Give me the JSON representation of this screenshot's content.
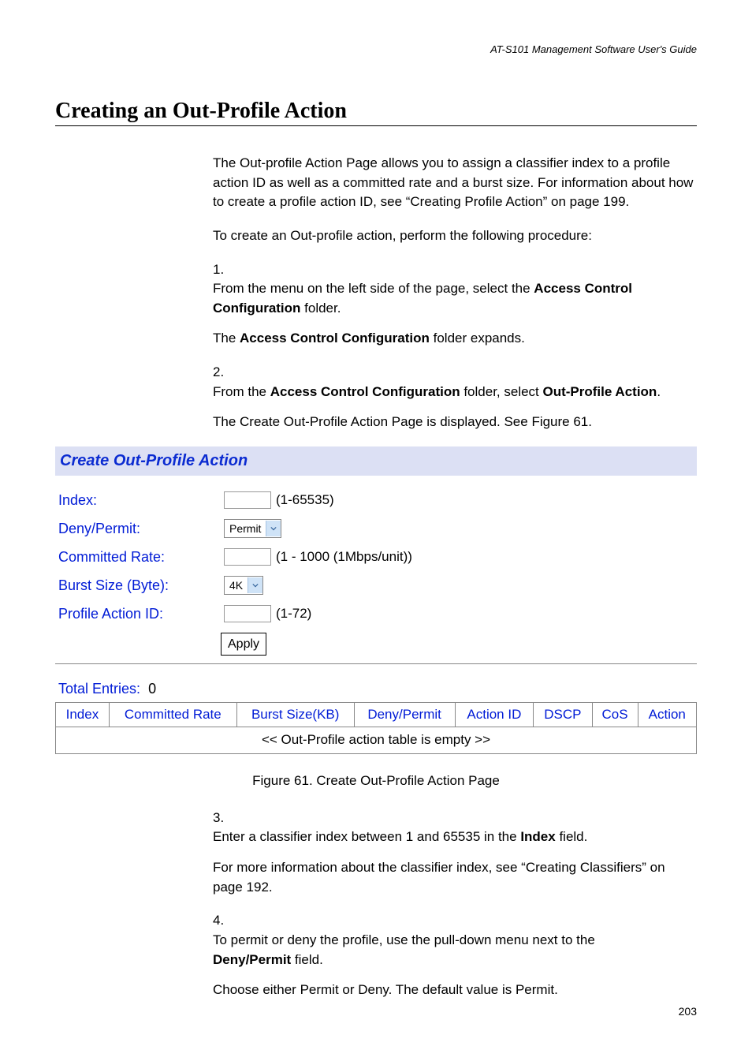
{
  "running_header": "AT-S101 Management Software User's Guide",
  "section_title": "Creating an Out-Profile Action",
  "intro_para": "The Out-profile Action Page allows you to assign a classifier index to a profile action ID as well as a committed rate and a burst size. For information about how to create a profile action ID, see “Creating Profile Action” on page 199.",
  "lead_in": "To create an Out-profile action, perform the following procedure:",
  "steps": {
    "s1_num": "1.",
    "s1_line1_a": "From the menu on the left side of the page, select the ",
    "s1_line1_b": "Access Control Configuration",
    "s1_line1_c": " folder.",
    "s1_line2_a": "The ",
    "s1_line2_b": "Access Control Configuration",
    "s1_line2_c": " folder expands.",
    "s2_num": "2.",
    "s2_line1_a": "From the ",
    "s2_line1_b": "Access Control Configuration",
    "s2_line1_c": " folder, select ",
    "s2_line1_d": "Out-Profile Action",
    "s2_line1_e": ".",
    "s2_line2": "The Create Out-Profile Action Page is displayed. See Figure 61.",
    "s3_num": "3.",
    "s3_line1_a": "Enter a classifier index between 1 and 65535 in the ",
    "s3_line1_b": "Index",
    "s3_line1_c": " field.",
    "s3_line2": "For more information about the classifier index, see “Creating Classifiers” on page 192.",
    "s4_num": "4.",
    "s4_line1_a": "To permit or deny the profile, use the pull-down menu next to the ",
    "s4_line1_b": "Deny/Permit",
    "s4_line1_c": " field.",
    "s4_line2": "Choose either Permit or Deny. The default value is Permit."
  },
  "figure": {
    "panel_title": "Create Out-Profile Action",
    "labels": {
      "index": "Index:",
      "deny_permit": "Deny/Permit:",
      "committed_rate": "Committed Rate:",
      "burst_size": "Burst Size (Byte):",
      "profile_action_id": "Profile Action ID:"
    },
    "hints": {
      "index": "(1-65535)",
      "committed_rate": "(1 - 1000 (1Mbps/unit))",
      "profile_action_id": "(1-72)"
    },
    "selects": {
      "deny_permit_value": "Permit",
      "burst_size_value": "4K"
    },
    "apply_label": "Apply",
    "total_entries_label": "Total Entries:",
    "total_entries_value": "0",
    "columns": {
      "c0": "Index",
      "c1": "Committed Rate",
      "c2": "Burst Size(KB)",
      "c3": "Deny/Permit",
      "c4": "Action ID",
      "c5": "DSCP",
      "c6": "CoS",
      "c7": "Action"
    },
    "empty_row": "<< Out-Profile action table is empty >>",
    "caption": "Figure 61. Create Out-Profile Action Page"
  },
  "page_number": "203"
}
